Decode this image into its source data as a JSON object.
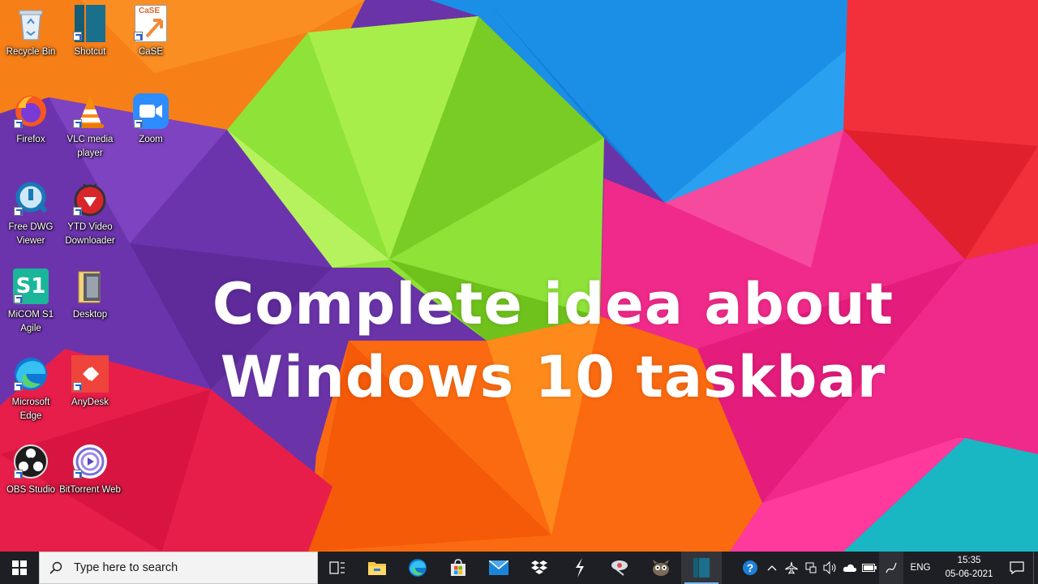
{
  "desktop": {
    "headline_line1": "Complete idea about",
    "headline_line2": "Windows 10 taskbar",
    "icons": [
      {
        "label": "Recycle Bin",
        "icon": "recycle-bin-icon"
      },
      {
        "label": "Shotcut",
        "icon": "shotcut-icon"
      },
      {
        "label": "CaSE",
        "icon": "case-icon"
      },
      {
        "label": "Firefox",
        "icon": "firefox-icon"
      },
      {
        "label": "VLC media player",
        "icon": "vlc-icon"
      },
      {
        "label": "Zoom",
        "icon": "zoom-icon"
      },
      {
        "label": "Free DWG Viewer",
        "icon": "dwg-viewer-icon"
      },
      {
        "label": "YTD Video Downloader",
        "icon": "ytd-downloader-icon"
      },
      {
        "label": "MiCOM S1 Agile",
        "icon": "micom-icon"
      },
      {
        "label": "Desktop",
        "icon": "folder-icon"
      },
      {
        "label": "Microsoft Edge",
        "icon": "edge-icon"
      },
      {
        "label": "AnyDesk",
        "icon": "anydesk-icon"
      },
      {
        "label": "OBS Studio",
        "icon": "obs-icon"
      },
      {
        "label": "BitTorrent Web",
        "icon": "bittorrent-icon"
      }
    ],
    "case_icon_text": "CaSE",
    "micom_icon_text": "S1"
  },
  "taskbar": {
    "search_placeholder": "Type here to search",
    "pinned": [
      "task-view-icon",
      "file-explorer-icon",
      "edge-icon",
      "store-icon",
      "mail-icon",
      "dropbox-icon",
      "winamp-icon",
      "satellite-icon",
      "gimp-icon",
      "shotcut-icon"
    ],
    "tray": {
      "language": "ENG",
      "time": "15:35",
      "date": "05-06-2021"
    }
  },
  "colors": {
    "taskbar_bg": "#1d1f24",
    "search_bg": "#f3f3f3",
    "accent": "#76b9ed"
  }
}
